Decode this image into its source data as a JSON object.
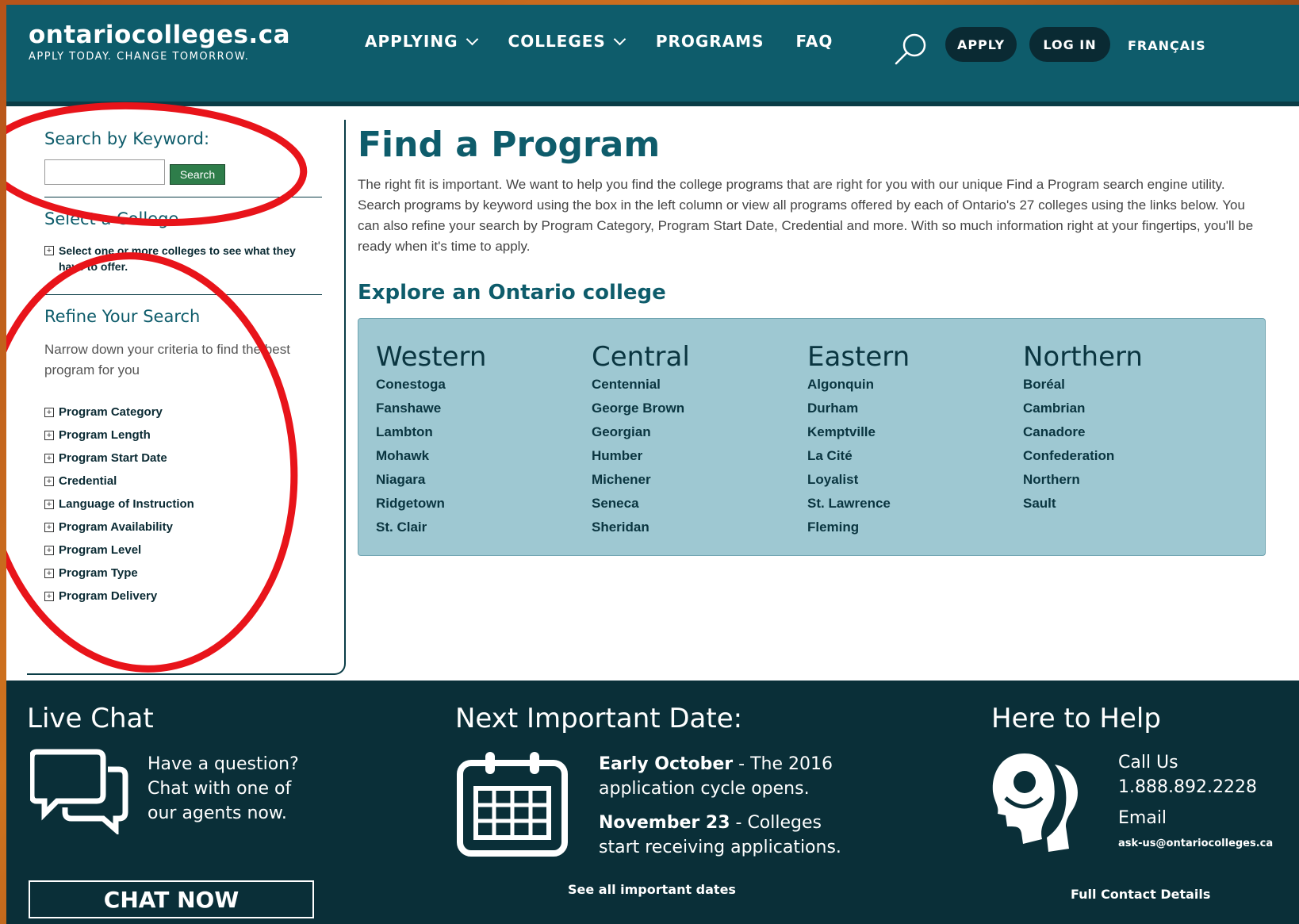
{
  "header": {
    "logo_name": "ontariocolleges.ca",
    "logo_tagline": "APPLY TODAY. CHANGE TOMORROW.",
    "nav": [
      "APPLYING",
      "COLLEGES",
      "PROGRAMS",
      "FAQ"
    ],
    "apply_label": "APPLY",
    "login_label": "LOG IN",
    "lang_label": "FRANÇAIS"
  },
  "sidebar": {
    "keyword_title": "Search by Keyword:",
    "keyword_value": "",
    "search_label": "Search",
    "college_title": "Select a College",
    "college_toggle": "Select one or more colleges to see what they have to offer.",
    "refine_title": "Refine Your Search",
    "refine_sub": "Narrow down your criteria to find the best program for you",
    "filters": [
      "Program Category",
      "Program Length",
      "Program Start Date",
      "Credential",
      "Language of Instruction",
      "Program Availability",
      "Program Level",
      "Program Type",
      "Program Delivery"
    ]
  },
  "main": {
    "title": "Find a Program",
    "intro": "The right fit is important. We want to help you find the college programs that are right for you with our unique Find a Program search engine utility. Search programs by keyword using the box in the left column or view all programs offered by each of Ontario's 27 colleges using the links below. You can also refine your search by Program Category, Program Start Date, Credential and more. With so much information right at your fingertips, you'll be ready when it's time to apply.",
    "explore_title": "Explore an Ontario college",
    "regions": [
      {
        "name": "Western",
        "colleges": [
          "Conestoga",
          "Fanshawe",
          "Lambton",
          "Mohawk",
          "Niagara",
          "Ridgetown",
          "St. Clair"
        ]
      },
      {
        "name": "Central",
        "colleges": [
          "Centennial",
          "George Brown",
          "Georgian",
          "Humber",
          "Michener",
          "Seneca",
          "Sheridan"
        ]
      },
      {
        "name": "Eastern",
        "colleges": [
          "Algonquin",
          "Durham",
          "Kemptville",
          "La Cité",
          "Loyalist",
          "St. Lawrence",
          "Fleming"
        ]
      },
      {
        "name": "Northern",
        "colleges": [
          "Boréal",
          "Cambrian",
          "Canadore",
          "Confederation",
          "Northern",
          "Sault"
        ]
      }
    ]
  },
  "footer": {
    "chat_title": "Live Chat",
    "chat_text": "Have a question? Chat with one of our agents now.",
    "chat_button": "CHAT NOW",
    "date_title": "Next Important Date:",
    "date1_bold": "Early October",
    "date1_text": " - The 2016 application cycle opens.",
    "date2_bold": "November 23",
    "date2_text": " - Colleges start receiving applications.",
    "dates_link": "See all important dates",
    "help_title": "Here to Help",
    "call_label": "Call Us",
    "phone": "1.888.892.2228",
    "email_label": "Email",
    "email": "ask-us@ontariocolleges.ca",
    "contact_link": "Full Contact Details"
  },
  "colors": {
    "header": "#0e5c6b",
    "footer": "#0a2f38",
    "region_panel": "#9ec8d2",
    "annotation": "#e8141a"
  }
}
